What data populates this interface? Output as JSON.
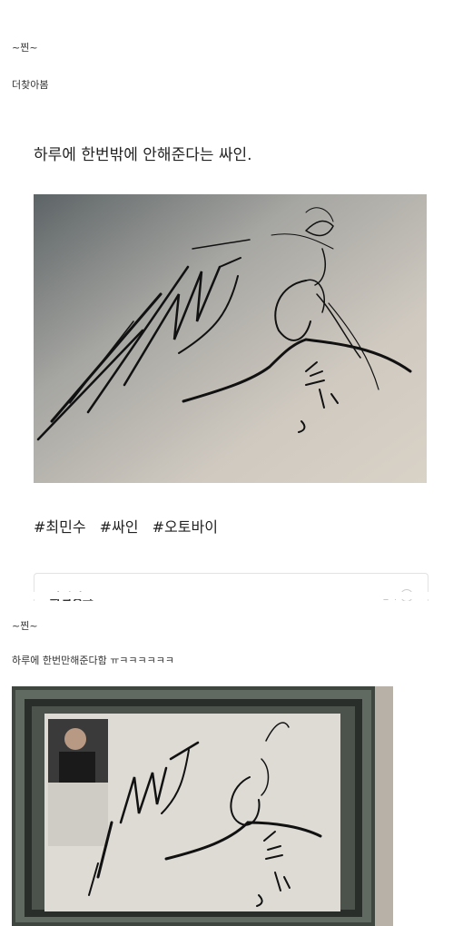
{
  "comment_1": {
    "author": "~찐~",
    "text": "더찾아봄"
  },
  "post": {
    "title": "하루에 한번밖에 안해준다는 싸인.",
    "tags": [
      "#최민수",
      "#싸인",
      "#오토바이"
    ],
    "card_title": "파일링크",
    "card_more": "접기"
  },
  "comment_2": {
    "author": "~찐~",
    "text": "하루에 한번만해준다함 ㅠㅋㅋㅋㅋㅋㅋ"
  },
  "colors": {
    "page_background": "#ffffff",
    "paper": "#dcd8d2",
    "frame": "#5a6158",
    "ink": "#111111"
  }
}
